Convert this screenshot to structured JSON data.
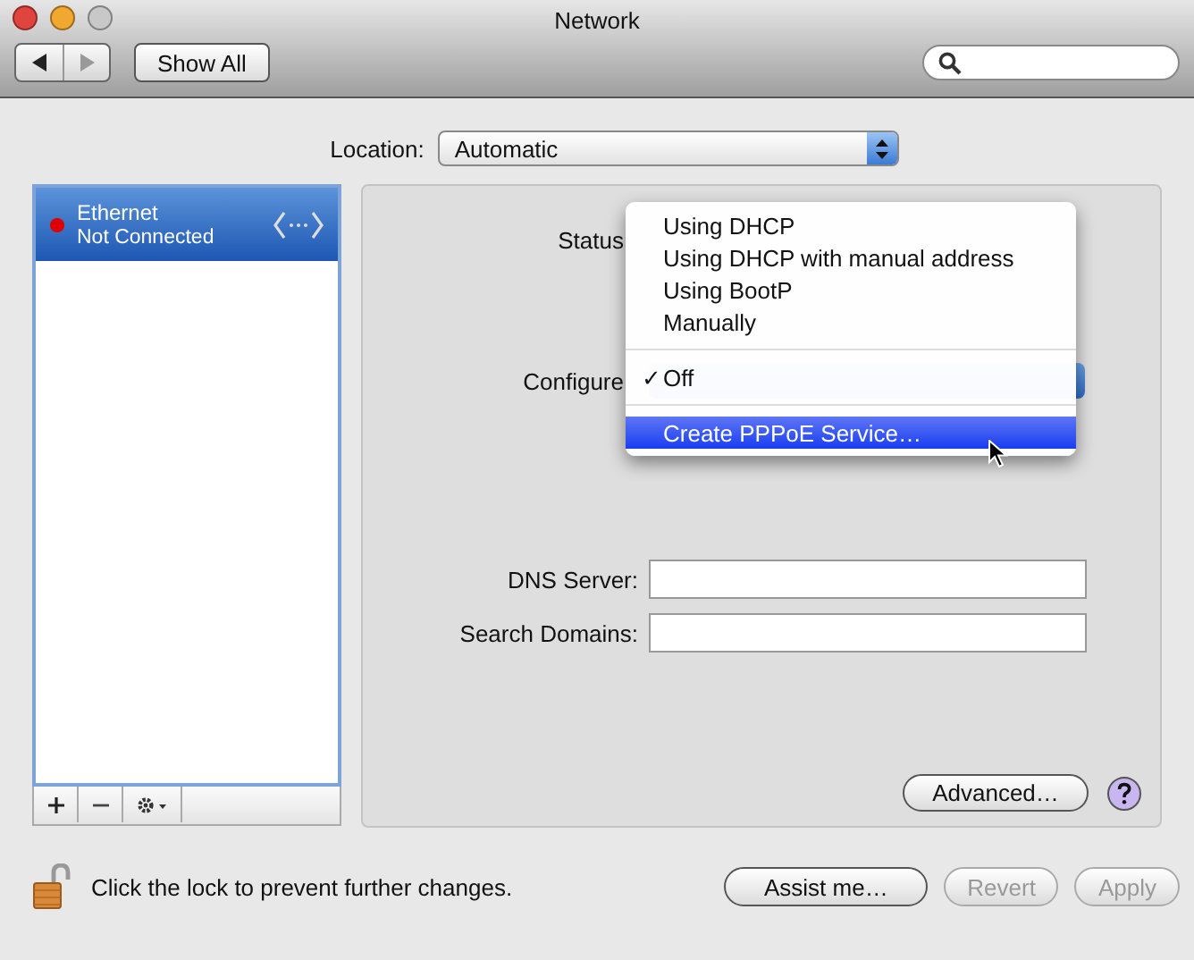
{
  "window": {
    "title": "Network",
    "controls": [
      {
        "kind": "close",
        "disabled": false
      },
      {
        "kind": "minimize",
        "disabled": false
      },
      {
        "kind": "zoom",
        "disabled": true
      }
    ]
  },
  "toolbar": {
    "nav": [
      {
        "kind": "back",
        "disabled": false
      },
      {
        "kind": "forward",
        "disabled": true
      }
    ],
    "show_all": "Show All"
  },
  "location": {
    "label": "Location:",
    "value": "Automatic"
  },
  "services": [
    {
      "name": "Ethernet",
      "status": "Not Connected",
      "color": "#dd0000",
      "selected": true
    }
  ],
  "form": {
    "status_label": "Status",
    "configure_label": "Configure",
    "fields": [
      {
        "label": "DNS Server:"
      },
      {
        "label": "Search Domains:"
      }
    ],
    "advanced": "Advanced…"
  },
  "menu": {
    "groups": [
      [
        {
          "label": "Using DHCP",
          "checked": false,
          "selected": false
        },
        {
          "label": "Using DHCP with manual address",
          "checked": false,
          "selected": false
        },
        {
          "label": "Using BootP",
          "checked": false,
          "selected": false
        },
        {
          "label": "Manually",
          "checked": false,
          "selected": false
        }
      ],
      [
        {
          "label": "Off",
          "checked": true,
          "selected": false
        }
      ],
      [
        {
          "label": "Create PPPoE Service…",
          "checked": false,
          "selected": true
        }
      ]
    ],
    "check_mark": "✓"
  },
  "footer": {
    "lock_text": "Click the lock to prevent further changes.",
    "buttons": [
      {
        "label": "Assist me…",
        "disabled": false
      },
      {
        "label": "Revert",
        "disabled": true
      },
      {
        "label": "Apply",
        "disabled": true
      }
    ]
  }
}
